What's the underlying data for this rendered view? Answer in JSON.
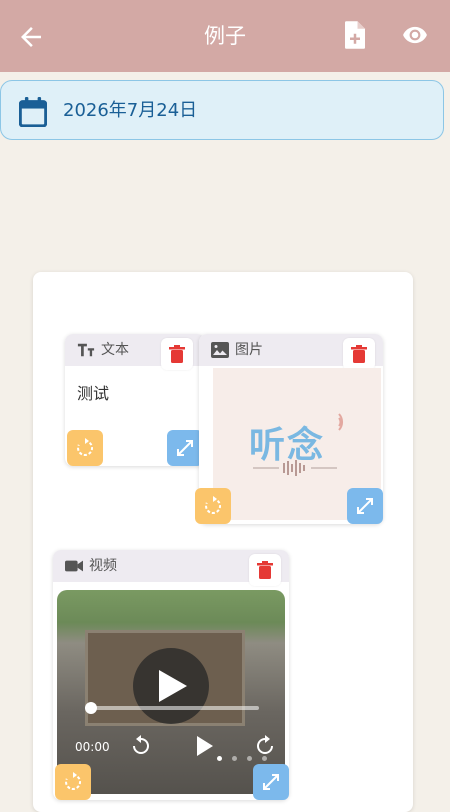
{
  "appbar": {
    "title": "例子",
    "back_icon": "arrow-back-icon",
    "add_icon": "note-add-icon",
    "preview_icon": "eye-icon",
    "color": "#d3a9a5"
  },
  "date": {
    "icon": "calendar-icon",
    "text": "2026年7月24日"
  },
  "cards": {
    "text": {
      "type_label": "文本",
      "icon": "text-fields-icon",
      "content": "测试"
    },
    "image": {
      "type_label": "图片",
      "icon": "image-icon",
      "logo_text": "听念"
    },
    "video": {
      "type_label": "视频",
      "icon": "videocam-icon",
      "time": "00:00",
      "progress": 0
    }
  },
  "colors": {
    "rotate": "#fbc56b",
    "resize": "#7cb9ec",
    "delete": "#e53935",
    "accent": "#1a5f96"
  }
}
